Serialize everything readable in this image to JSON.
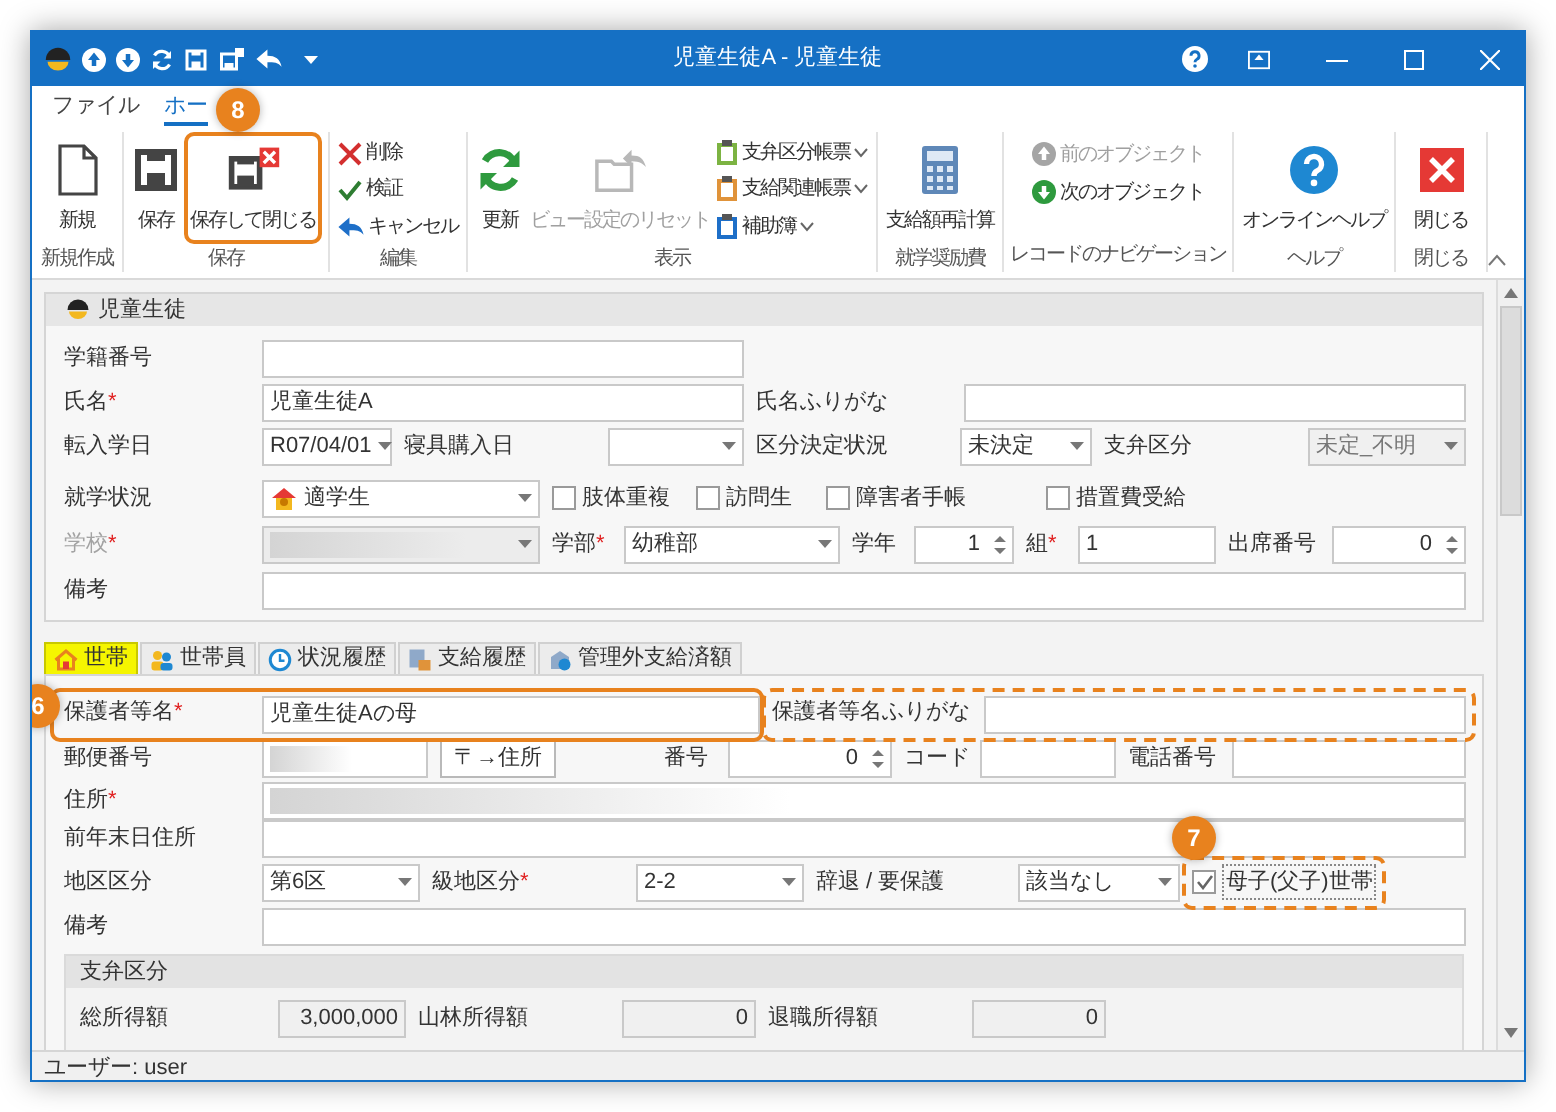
{
  "window": {
    "title": "児童生徒A - 児童生徒"
  },
  "ribbon_tabs": [
    {
      "label": "ファイル",
      "selected": false
    },
    {
      "label": "ホー",
      "selected": true
    }
  ],
  "ribbon_groups": [
    {
      "label": "新規作成",
      "items": [
        {
          "kind": "large",
          "label": "新規",
          "disabled": false,
          "dropdown": false
        }
      ]
    },
    {
      "label": "保存",
      "items": [
        {
          "kind": "large",
          "label": "保存",
          "disabled": false,
          "dropdown": false
        },
        {
          "kind": "large",
          "label": "保存して閉じる",
          "disabled": false,
          "dropdown": false,
          "callout": {
            "number": "8",
            "kind": "main"
          }
        }
      ]
    },
    {
      "label": "編集",
      "items": [
        {
          "kind": "small",
          "label": "削除",
          "disabled": false,
          "dropdown": false
        },
        {
          "kind": "small",
          "label": "検証",
          "disabled": false,
          "dropdown": false
        },
        {
          "kind": "small",
          "label": "キャンセル",
          "disabled": false,
          "dropdown": false
        }
      ]
    },
    {
      "label": "表示",
      "items": [
        {
          "kind": "large",
          "label": "更新",
          "disabled": false,
          "dropdown": false
        },
        {
          "kind": "large",
          "label": "ビュー設定のリセット",
          "disabled": true,
          "dropdown": false
        },
        {
          "kind": "small",
          "label": "支弁区分帳票",
          "disabled": false,
          "dropdown": true
        },
        {
          "kind": "small",
          "label": "支給関連帳票",
          "disabled": false,
          "dropdown": true
        },
        {
          "kind": "small",
          "label": "補助簿",
          "disabled": false,
          "dropdown": true
        }
      ]
    },
    {
      "label": "就学奨励費",
      "items": [
        {
          "kind": "large",
          "label": "支給額再計算",
          "disabled": false,
          "dropdown": false
        }
      ]
    },
    {
      "label": "レコードのナビゲーション",
      "items": [
        {
          "kind": "small",
          "label": "前のオブジェクト",
          "disabled": true,
          "dropdown": false
        },
        {
          "kind": "small",
          "label": "次のオブジェクト",
          "disabled": false,
          "dropdown": false
        }
      ]
    },
    {
      "label": "ヘルプ",
      "items": [
        {
          "kind": "large",
          "label": "オンラインヘルプ",
          "disabled": false,
          "dropdown": false
        }
      ]
    },
    {
      "label": "閉じる",
      "items": [
        {
          "kind": "large",
          "label": "閉じる",
          "disabled": false,
          "dropdown": false
        }
      ]
    }
  ],
  "student_section": {
    "title": "児童生徒",
    "fields": [
      {
        "label": {
          "text": "学籍番号",
          "disabled": false
        },
        "control": {
          "kind": "text"
        }
      },
      {
        "label": {
          "text": "氏名",
          "required_mark": "*",
          "disabled": false
        },
        "control": {
          "kind": "text",
          "value": "児童生徒A"
        }
      },
      {
        "label": {
          "text": "氏名ふりがな",
          "disabled": false
        },
        "control": {
          "kind": "text"
        }
      },
      {
        "label": {
          "text": "転入学日",
          "disabled": false
        },
        "control": {
          "kind": "select",
          "value": "R07/04/01",
          "disabled": false
        }
      },
      {
        "label": {
          "text": "寝具購入日",
          "disabled": false
        },
        "control": {
          "kind": "select",
          "disabled": false
        }
      },
      {
        "label": {
          "text": "区分決定状況",
          "disabled": false
        },
        "control": {
          "kind": "select",
          "value": "未決定",
          "disabled": false
        }
      },
      {
        "label": {
          "text": "支弁区分",
          "disabled": false
        },
        "control": {
          "kind": "select",
          "value": "未定_不明",
          "disabled": true
        }
      },
      {
        "label": {
          "text": "就学状況",
          "disabled": false
        },
        "control": {
          "kind": "icon_select",
          "value": "適学生",
          "disabled": false
        }
      },
      {
        "control": {
          "kind": "checkbox",
          "label": "肢体重複",
          "checked": false
        }
      },
      {
        "control": {
          "kind": "checkbox",
          "label": "訪問生",
          "checked": false
        }
      },
      {
        "control": {
          "kind": "checkbox",
          "label": "障害者手帳",
          "checked": false
        }
      },
      {
        "control": {
          "kind": "checkbox",
          "label": "措置費受給",
          "checked": false
        }
      },
      {
        "label": {
          "text": "学校",
          "required_mark": "*",
          "disabled": true
        },
        "control": {
          "kind": "redacted_select",
          "disabled": true
        }
      },
      {
        "label": {
          "text": "学部",
          "required_mark": "*",
          "disabled": false
        },
        "control": {
          "kind": "select",
          "value": "幼稚部",
          "disabled": false
        }
      },
      {
        "label": {
          "text": "学年",
          "disabled": false
        },
        "control": {
          "kind": "spin",
          "value": "1"
        }
      },
      {
        "label": {
          "text": "組",
          "required_mark": "*",
          "disabled": false
        },
        "control": {
          "kind": "text",
          "value": "1"
        }
      },
      {
        "label": {
          "text": "出席番号",
          "disabled": false
        },
        "control": {
          "kind": "spin",
          "value": "0"
        }
      },
      {
        "label": {
          "text": "備考",
          "disabled": false
        },
        "control": {
          "kind": "text"
        }
      }
    ]
  },
  "detail_tabs": [
    {
      "label": "世帯",
      "selected": true
    },
    {
      "label": "世帯員",
      "selected": false
    },
    {
      "label": "状況履歴",
      "selected": false
    },
    {
      "label": "支給履歴",
      "selected": false
    },
    {
      "label": "管理外支給済額",
      "selected": false
    }
  ],
  "household_tab": {
    "fields": [
      {
        "label": {
          "text": "保護者等名",
          "required_mark": "*",
          "disabled": false
        },
        "control": {
          "kind": "text",
          "value": "児童生徒Aの母"
        },
        "callout": {
          "number": "6",
          "kind": "main"
        }
      },
      {
        "label": {
          "text": "保護者等名ふりがな",
          "disabled": false
        },
        "control": {
          "kind": "text"
        },
        "callout": {
          "kind": "related"
        }
      },
      {
        "label": {
          "text": "郵便番号",
          "disabled": false
        },
        "control": {
          "kind": "redacted_text"
        }
      },
      {
        "control": {
          "kind": "button",
          "label": "〒→住所"
        }
      },
      {
        "label": {
          "text": "番号",
          "disabled": false
        },
        "control": {
          "kind": "spin",
          "value": "0"
        }
      },
      {
        "label": {
          "text": "コード",
          "disabled": false
        },
        "control": {
          "kind": "text"
        }
      },
      {
        "label": {
          "text": "電話番号",
          "disabled": false
        },
        "control": {
          "kind": "text"
        }
      },
      {
        "label": {
          "text": "住所",
          "required_mark": "*",
          "disabled": false
        },
        "control": {
          "kind": "redacted_text"
        }
      },
      {
        "label": {
          "text": "前年末日住所",
          "disabled": false
        },
        "control": {
          "kind": "text"
        }
      },
      {
        "label": {
          "text": "地区区分",
          "disabled": false
        },
        "control": {
          "kind": "select",
          "value": "第6区",
          "disabled": false
        }
      },
      {
        "label": {
          "text": "級地区分",
          "required_mark": "*",
          "disabled": false
        },
        "control": {
          "kind": "select",
          "value": "2-2",
          "disabled": false
        }
      },
      {
        "label": {
          "text": "辞退 / 要保護",
          "disabled": false
        },
        "control": {
          "kind": "select",
          "value": "該当なし",
          "disabled": false
        }
      },
      {
        "control": {
          "kind": "checkbox",
          "label": "母子(父子)世帯",
          "checked": true
        },
        "callout": {
          "number": "7",
          "kind": "related"
        }
      },
      {
        "label": {
          "text": "備考",
          "disabled": false
        },
        "control": {
          "kind": "text"
        }
      }
    ],
    "subsection": {
      "title": "支弁区分",
      "fields": [
        {
          "label": {
            "text": "総所得額",
            "disabled": false
          },
          "control": {
            "kind": "number",
            "value": "3,000,000"
          }
        },
        {
          "label": {
            "text": "山林所得額",
            "disabled": false
          },
          "control": {
            "kind": "number",
            "value": "0"
          }
        },
        {
          "label": {
            "text": "退職所得額",
            "disabled": false
          },
          "control": {
            "kind": "number",
            "value": "0"
          }
        }
      ]
    }
  },
  "status_bar": {
    "text": "ユーザー: user"
  }
}
